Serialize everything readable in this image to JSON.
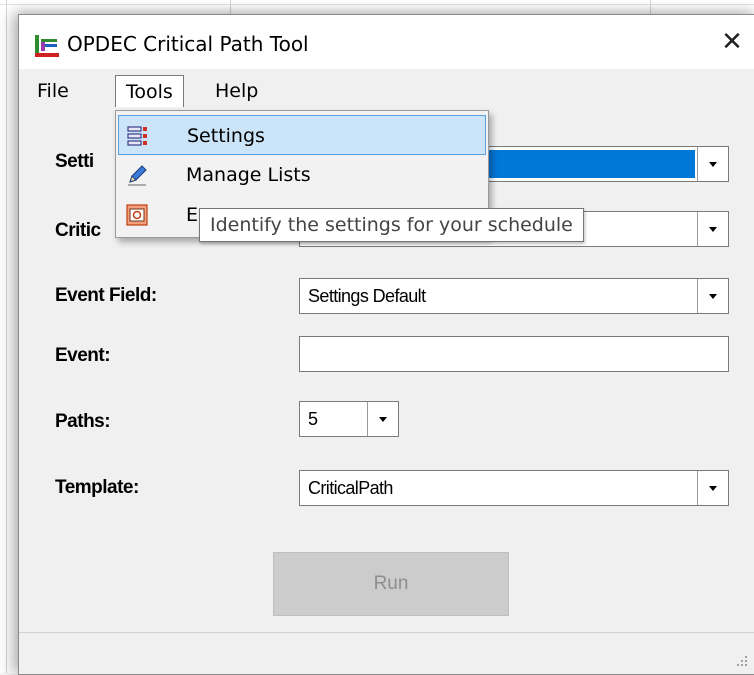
{
  "window": {
    "title": "OPDEC Critical Path Tool",
    "close_symbol": "✕"
  },
  "menubar": {
    "items": [
      {
        "label": "File"
      },
      {
        "label": "Tools"
      },
      {
        "label": "Help"
      }
    ]
  },
  "tools_menu": {
    "items": [
      {
        "label": "Settings",
        "icon": "settings-list-icon",
        "highlighted": true
      },
      {
        "label": "Manage Lists",
        "icon": "edit-pencil-icon"
      },
      {
        "label": "E",
        "icon": "export-icon"
      }
    ]
  },
  "tooltip": {
    "text": "Identify the settings for your schedule"
  },
  "form": {
    "settings_label": "Setti",
    "critical_label": "Critic",
    "event_field_label": "Event Field:",
    "event_field_value": "Settings Default",
    "event_label": "Event:",
    "event_value": "",
    "paths_label": "Paths:",
    "paths_value": "5",
    "template_label": "Template:",
    "template_value": "CriticalPath"
  },
  "run_button": {
    "label": "Run",
    "enabled": false
  },
  "colors": {
    "selection_blue": "#0078d7",
    "menu_highlight": "#cce4f7"
  }
}
